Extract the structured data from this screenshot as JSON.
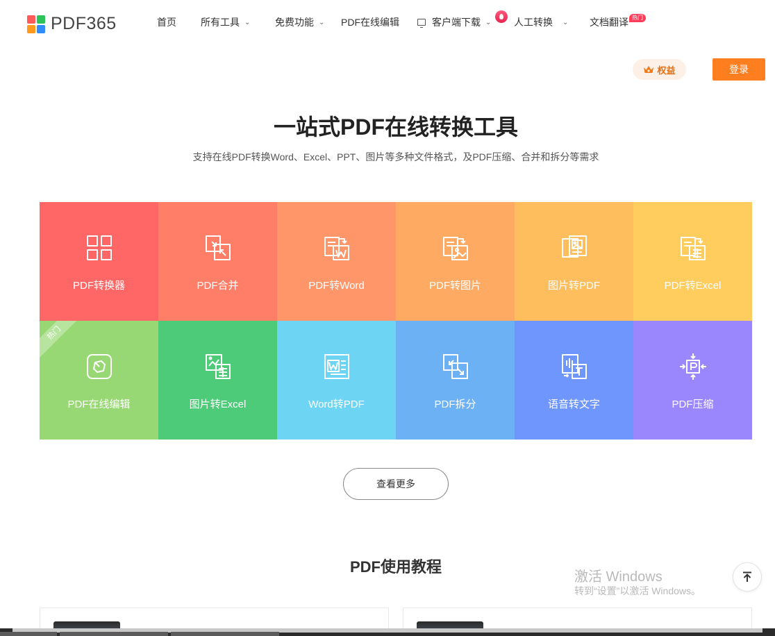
{
  "header": {
    "logo_text": "PDF365",
    "nav": [
      {
        "label": "首页"
      },
      {
        "label": "所有工具"
      },
      {
        "label": "免费功能"
      },
      {
        "label": "PDF在线编辑"
      },
      {
        "label": "客户端下载"
      },
      {
        "label": "人工转换"
      },
      {
        "label": "文档翻译"
      }
    ],
    "hot_tag": "热门",
    "equity_label": "权益",
    "login_label": "登录"
  },
  "hero": {
    "title": "一站式PDF在线转换工具",
    "subtitle": "支持在线PDF转换Word、Excel、PPT、图片等多种文件格式，及PDF压缩、合并和拆分等需求"
  },
  "tools": [
    {
      "label": "PDF转换器",
      "color": "#ff6767",
      "icon": "grid-icon"
    },
    {
      "label": "PDF合并",
      "color": "#fe7e67",
      "icon": "merge-icon"
    },
    {
      "label": "PDF转Word",
      "color": "#ff966a",
      "icon": "pdf-to-word-icon"
    },
    {
      "label": "PDF转图片",
      "color": "#ffaa62",
      "icon": "pdf-to-image-icon"
    },
    {
      "label": "图片转PDF",
      "color": "#ffbe5d",
      "icon": "image-to-pdf-icon"
    },
    {
      "label": "PDF转Excel",
      "color": "#ffcc5e",
      "icon": "pdf-to-excel-icon"
    },
    {
      "label": "PDF在线编辑",
      "color": "#98d874",
      "icon": "edit-icon",
      "ribbon": "热门"
    },
    {
      "label": "图片转Excel",
      "color": "#4ecb78",
      "icon": "image-to-excel-icon"
    },
    {
      "label": "Word转PDF",
      "color": "#6dd4f3",
      "icon": "word-to-pdf-icon"
    },
    {
      "label": "PDF拆分",
      "color": "#6db1f5",
      "icon": "split-icon"
    },
    {
      "label": "语音转文字",
      "color": "#6f96fc",
      "icon": "voice-to-text-icon"
    },
    {
      "label": "PDF压缩",
      "color": "#9a87fe",
      "icon": "compress-icon"
    }
  ],
  "more_label": "查看更多",
  "section_title": "PDF使用教程",
  "watermark": {
    "line1": "激活 Windows",
    "line2": "转到“设置”以激活 Windows。"
  }
}
